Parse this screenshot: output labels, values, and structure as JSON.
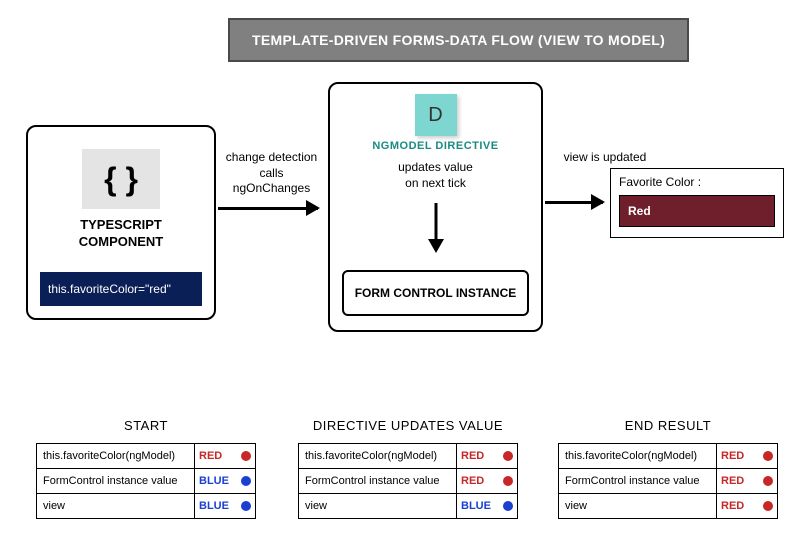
{
  "title": "TEMPLATE-DRIVEN FORMS-DATA FLOW (VIEW TO MODEL)",
  "typescript": {
    "label1": "TYPESCRIPT",
    "label2": "COMPONENT",
    "code": "this.favoriteColor=\"red\""
  },
  "connector1": {
    "line1": "change detection",
    "line2": "calls",
    "line3": "ngOnChanges"
  },
  "ngmodel": {
    "badge": "D",
    "title": "NGMODEL DIRECTIVE",
    "sub1": "updates value",
    "sub2": "on next tick",
    "formControl": "FORM CONTROL INSTANCE"
  },
  "connector2": "view is updated",
  "output": {
    "label": "Favorite Color :",
    "value": "Red"
  },
  "states": [
    {
      "title": "START",
      "rows": [
        {
          "label": "this.favoriteColor(ngModel)",
          "color": "RED"
        },
        {
          "label": "FormControl instance value",
          "color": "BLUE"
        },
        {
          "label": "view",
          "color": "BLUE"
        }
      ]
    },
    {
      "title": "DIRECTIVE UPDATES VALUE",
      "rows": [
        {
          "label": "this.favoriteColor(ngModel)",
          "color": "RED"
        },
        {
          "label": "FormControl instance value",
          "color": "RED"
        },
        {
          "label": "view",
          "color": "BLUE"
        }
      ]
    },
    {
      "title": "END RESULT",
      "rows": [
        {
          "label": "this.favoriteColor(ngModel)",
          "color": "RED"
        },
        {
          "label": "FormControl instance value",
          "color": "RED"
        },
        {
          "label": "view",
          "color": "RED"
        }
      ]
    }
  ]
}
